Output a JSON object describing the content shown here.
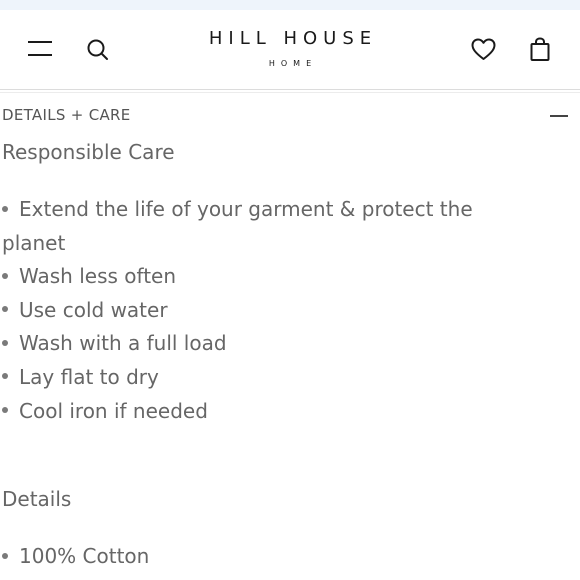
{
  "header": {
    "brand_name": "HILL HOUSE",
    "brand_sub": "HOME",
    "icons": {
      "menu": "hamburger-menu-icon",
      "search": "search-icon",
      "wishlist": "heart-icon",
      "cart": "shopping-bag-icon"
    },
    "accent_color": "#1a1a1a",
    "strip_color": "#eef4fb"
  },
  "details_care": {
    "section_title": "DETAILS + CARE",
    "toggle_icon": "collapse-minus-icon",
    "care_heading": "Responsible Care",
    "care_items": [
      "Extend the life of your garment & protect the planet",
      "Wash less often",
      "Use cold water",
      "Wash with a full load",
      "Lay flat to dry",
      "Cool iron if needed"
    ],
    "details_heading": "Details",
    "details_items": [
      "100% Cotton"
    ]
  }
}
